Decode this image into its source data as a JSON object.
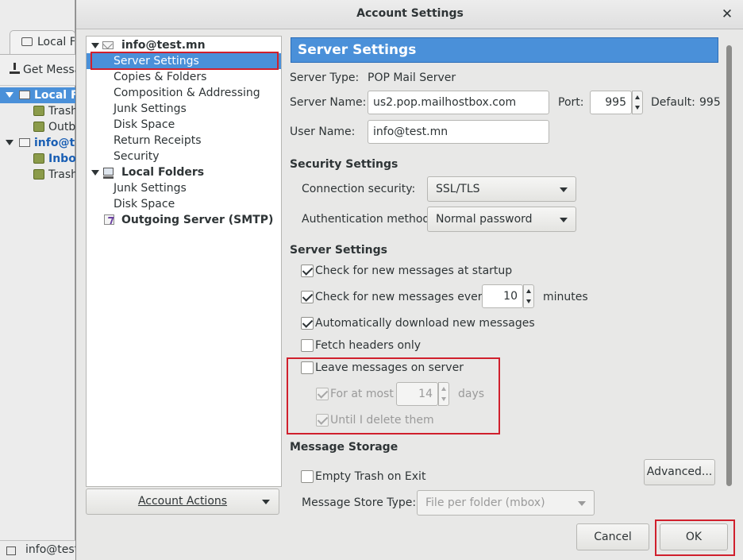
{
  "background": {
    "tab_label": "Local F",
    "toolbar_label": "Get Messa",
    "folders": [
      {
        "label": "Local Fo",
        "kind": "account-local",
        "selected": true
      },
      {
        "label": "Trash",
        "kind": "folder"
      },
      {
        "label": "Outb",
        "kind": "folder"
      },
      {
        "label": "info@te",
        "kind": "account-mail"
      },
      {
        "label": "Inbox",
        "kind": "inbox"
      },
      {
        "label": "Trash",
        "kind": "folder"
      }
    ],
    "status_text": "info@test"
  },
  "dialog": {
    "title": "Account Settings",
    "close_glyph": "✕"
  },
  "tree": {
    "items": [
      {
        "label": "info@test.mn",
        "level": 0,
        "bold": true,
        "icon": "mail-account-icon",
        "expanded": true
      },
      {
        "label": "Server Settings",
        "level": 1,
        "selected": true
      },
      {
        "label": "Copies & Folders",
        "level": 1
      },
      {
        "label": "Composition & Addressing",
        "level": 1
      },
      {
        "label": "Junk Settings",
        "level": 1
      },
      {
        "label": "Disk Space",
        "level": 1
      },
      {
        "label": "Return Receipts",
        "level": 1
      },
      {
        "label": "Security",
        "level": 1
      },
      {
        "label": "Local Folders",
        "level": 0,
        "bold": true,
        "icon": "computer-icon",
        "expanded": true
      },
      {
        "label": "Junk Settings",
        "level": 1
      },
      {
        "label": "Disk Space",
        "level": 1
      },
      {
        "label": "Outgoing Server (SMTP)",
        "level": 0,
        "bold": true,
        "icon": "smtp-icon"
      }
    ],
    "account_actions_label": "Account Actions"
  },
  "server": {
    "header": "Server Settings",
    "type_label": "Server Type:",
    "type_value": "POP Mail Server",
    "name_label": "Server Name:",
    "name_value": "us2.pop.mailhostbox.com",
    "port_label": "Port:",
    "port_value": "995",
    "default_label": "Default:",
    "default_value": "995",
    "user_label": "User Name:",
    "user_value": "info@test.mn"
  },
  "security": {
    "section_title": "Security Settings",
    "conn_label": "Connection security:",
    "conn_value": "SSL/TLS",
    "auth_label": "Authentication method:",
    "auth_value": "Normal password"
  },
  "options": {
    "section_title": "Server Settings",
    "check_startup": {
      "label": "Check for new messages at startup",
      "checked": true
    },
    "check_every": {
      "label": "Check for new messages every",
      "checked": true,
      "value": "10",
      "unit": "minutes"
    },
    "auto_download": {
      "label": "Automatically download new messages",
      "checked": true
    },
    "fetch_headers": {
      "label": "Fetch headers only",
      "checked": false
    },
    "leave_on_server": {
      "label": "Leave messages on server",
      "checked": false
    },
    "for_at_most": {
      "label": "For at most",
      "checked": true,
      "disabled": true,
      "value": "14",
      "unit": "days"
    },
    "until_delete": {
      "label": "Until I delete them",
      "checked": true,
      "disabled": true
    }
  },
  "storage": {
    "section_title": "Message Storage",
    "advanced_label": "Advanced...",
    "empty_trash": {
      "label": "Empty Trash on Exit",
      "checked": false
    },
    "store_type_label": "Message Store Type:",
    "store_type_value": "File per folder (mbox)"
  },
  "footer": {
    "cancel_label": "Cancel",
    "ok_label": "OK"
  },
  "colors": {
    "selection": "#4a90d9",
    "highlight_annotation": "#d0202d"
  }
}
